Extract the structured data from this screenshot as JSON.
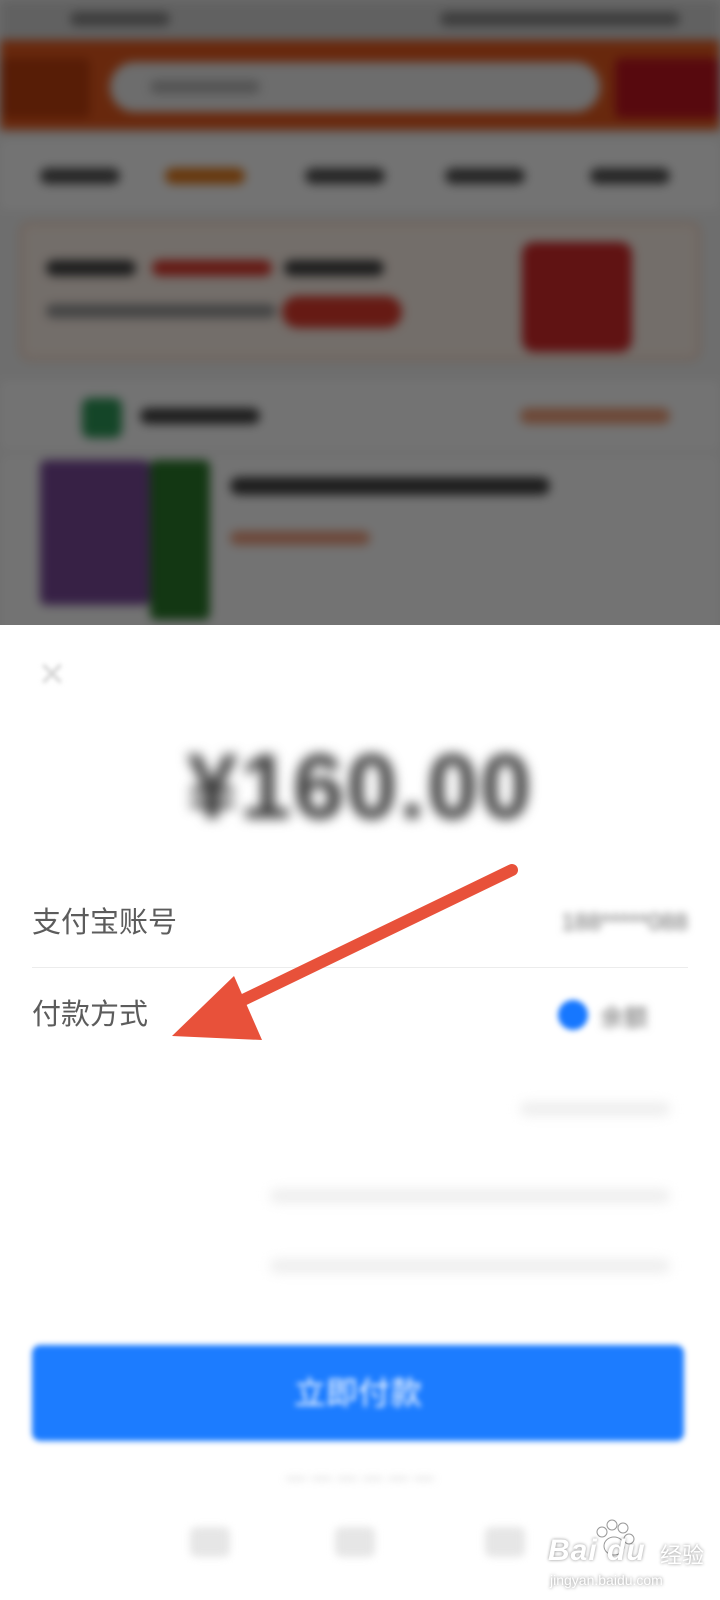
{
  "payment_sheet": {
    "close_icon": "close-icon",
    "amount": "¥160.00",
    "rows": [
      {
        "label": "支付宝账号",
        "value": "188*****088"
      },
      {
        "label": "付款方式",
        "value": "余额",
        "icon": "alipay-icon"
      }
    ],
    "confirm_label": "立即付款"
  },
  "annotation": {
    "arrow_color": "#e8513a",
    "points_to": "付款方式"
  },
  "watermark": {
    "brand": "Bai du",
    "product": "经验",
    "url": "jingyan.baidu.com"
  },
  "colors": {
    "primary_button": "#1c7cff",
    "header_orange": "#e75a1e",
    "arrow": "#e8513a"
  }
}
